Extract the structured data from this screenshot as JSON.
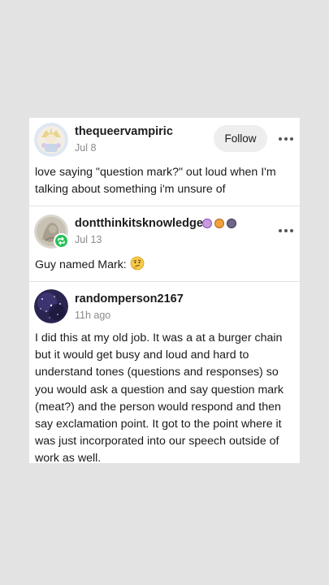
{
  "posts": [
    {
      "username": "thequeervampiric",
      "date": "Jul 8",
      "follow_label": "Follow",
      "text": "love saying \"question mark?\" out loud when I'm talking about something i'm unsure of"
    },
    {
      "username": "dontthinkitsknowledge",
      "date": "Jul 13",
      "text": "Guy named Mark:",
      "emoji": "thinking-face-emoji"
    },
    {
      "username": "randomperson2167",
      "date": "11h ago",
      "text": "I did this at my old job. It was a at a burger chain but it would get busy and loud and hard to understand tones (questions and responses) so you would ask a question and say question mark (meat?) and the person would respond and then say exclamation point. It got to the point where it was just incorporated into our speech outside of work as well."
    }
  ],
  "colors": {
    "background": "#e3e3e3",
    "card": "#ffffff",
    "reblog_badge": "#27c05a",
    "follow_button": "#eeeeee",
    "muted_text": "#8a8a8a"
  },
  "icons": {
    "more": "more-options-icon",
    "reblog": "reblog-icon",
    "badges": [
      "purple-brain-badge",
      "orange-paw-badge",
      "dark-creature-badge"
    ]
  }
}
